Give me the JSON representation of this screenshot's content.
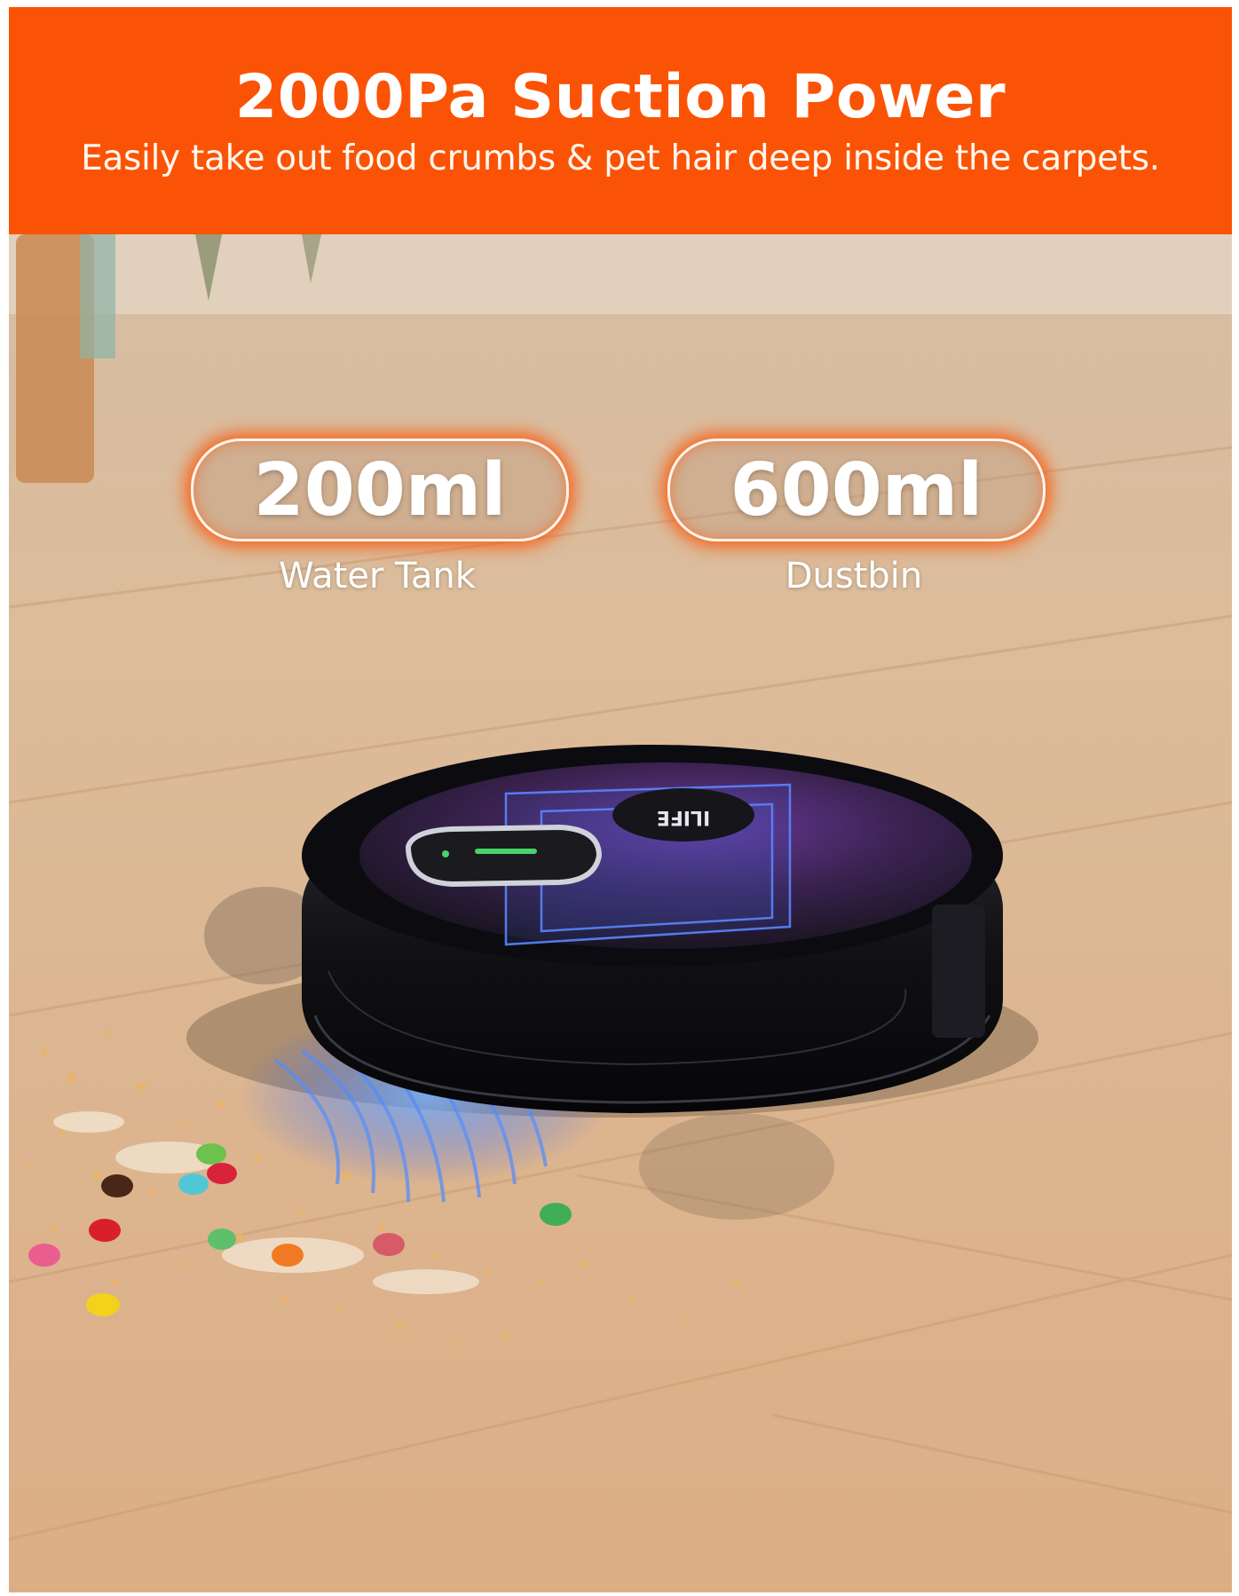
{
  "banner": {
    "title": "2000Pa Suction Power",
    "subtitle": "Easily take out food crumbs & pet hair deep inside the carpets.",
    "color": "#fb5305"
  },
  "specs": [
    {
      "value": "200ml",
      "label": "Water Tank"
    },
    {
      "value": "600ml",
      "label": "Dustbin"
    }
  ],
  "product": {
    "brand": "ILIFE"
  },
  "colors": {
    "accent": "#fb5305",
    "floor": "#dfbc97",
    "robot": "#1a1a1e",
    "suction_glow": "#3b7dff"
  }
}
